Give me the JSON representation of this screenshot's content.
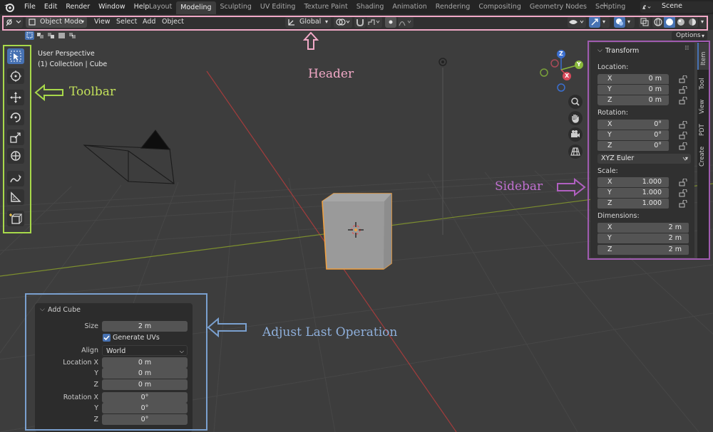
{
  "topbar": {
    "menus": [
      "File",
      "Edit",
      "Render",
      "Window",
      "Help"
    ],
    "tabs": [
      "Layout",
      "Modeling",
      "Sculpting",
      "UV Editing",
      "Texture Paint",
      "Shading",
      "Animation",
      "Rendering",
      "Compositing",
      "Geometry Nodes",
      "Scripting"
    ],
    "active_tab": "Modeling",
    "add_tab": "+",
    "scene": "Scene"
  },
  "header": {
    "mode": "Object Mode",
    "menus": [
      "View",
      "Select",
      "Add",
      "Object"
    ],
    "orientation": "Global",
    "options": "Options"
  },
  "viewport": {
    "view_name": "User Perspective",
    "collection": "(1) Collection | Cube",
    "gizmo_axes": [
      "Z",
      "Y",
      "X"
    ]
  },
  "annotations": {
    "header": "Header",
    "toolbar": "Toolbar",
    "sidebar": "Sidebar",
    "adjust": "Adjust Last Operation"
  },
  "sidebar": {
    "panel_title": "Transform",
    "tabs": [
      "Item",
      "Tool",
      "View",
      "PDT",
      "Create"
    ],
    "location_label": "Location:",
    "location": [
      {
        "axis": "X",
        "value": "0 m"
      },
      {
        "axis": "Y",
        "value": "0 m"
      },
      {
        "axis": "Z",
        "value": "0 m"
      }
    ],
    "rotation_label": "Rotation:",
    "rotation": [
      {
        "axis": "X",
        "value": "0°"
      },
      {
        "axis": "Y",
        "value": "0°"
      },
      {
        "axis": "Z",
        "value": "0°"
      }
    ],
    "rotation_mode": "XYZ Euler",
    "scale_label": "Scale:",
    "scale": [
      {
        "axis": "X",
        "value": "1.000"
      },
      {
        "axis": "Y",
        "value": "1.000"
      },
      {
        "axis": "Z",
        "value": "1.000"
      }
    ],
    "dimensions_label": "Dimensions:",
    "dimensions": [
      {
        "axis": "X",
        "value": "2 m"
      },
      {
        "axis": "Y",
        "value": "2 m"
      },
      {
        "axis": "Z",
        "value": "2 m"
      }
    ]
  },
  "adjust_panel": {
    "title": "Add Cube",
    "size_label": "Size",
    "size_value": "2 m",
    "generate_uvs": "Generate UVs",
    "align_label": "Align",
    "align_value": "World",
    "location_x_label": "Location X",
    "location_y_label": "Y",
    "location_z_label": "Z",
    "location": [
      "0 m",
      "0 m",
      "0 m"
    ],
    "rotation_x_label": "Rotation X",
    "rotation_y_label": "Y",
    "rotation_z_label": "Z",
    "rotation": [
      "0°",
      "0°",
      "0°"
    ]
  },
  "colors": {
    "header_box": "#f2a9c7",
    "toolbar_box": "#a8d94a",
    "sidebar_box": "#a05bb0",
    "adjust_box": "#7aa0cf",
    "selection_orange": "#f0a040",
    "active_blue": "#4772b3"
  }
}
